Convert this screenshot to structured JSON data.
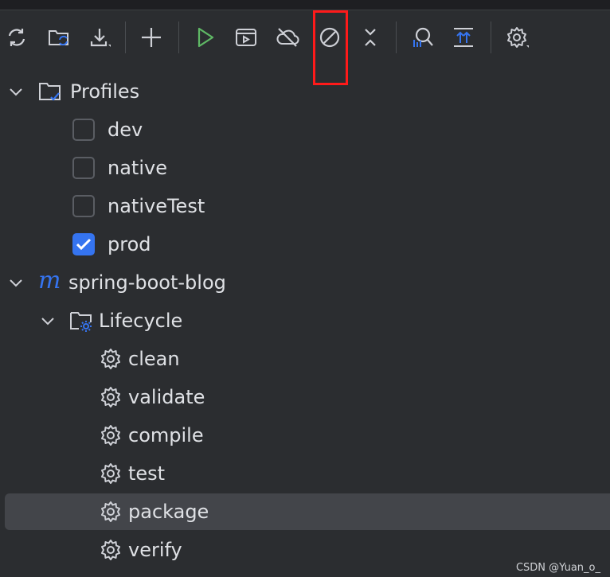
{
  "toolbar": {
    "buttons": [
      {
        "name": "reload-icon"
      },
      {
        "name": "generate-sources-icon"
      },
      {
        "name": "download-icon"
      },
      {
        "name": "add-icon"
      },
      {
        "name": "run-icon"
      },
      {
        "name": "execute-goal-icon"
      },
      {
        "name": "offline-mode-icon"
      },
      {
        "name": "skip-tests-icon"
      },
      {
        "name": "collapse-all-icon"
      },
      {
        "name": "analyze-dependencies-icon"
      },
      {
        "name": "show-dependencies-icon"
      },
      {
        "name": "settings-icon"
      }
    ],
    "highlight_color": "#ff1a1a",
    "accent_color": "#3574f0"
  },
  "tree": {
    "profiles": {
      "label": "Profiles",
      "items": [
        {
          "label": "dev",
          "checked": false
        },
        {
          "label": "native",
          "checked": false
        },
        {
          "label": "nativeTest",
          "checked": false
        },
        {
          "label": "prod",
          "checked": true
        }
      ]
    },
    "project": {
      "icon_letter": "m",
      "label": "spring-boot-blog",
      "lifecycle": {
        "label": "Lifecycle",
        "goals": [
          "clean",
          "validate",
          "compile",
          "test",
          "package",
          "verify"
        ],
        "selected": "package"
      }
    }
  },
  "watermark": "CSDN @Yuan_o_"
}
